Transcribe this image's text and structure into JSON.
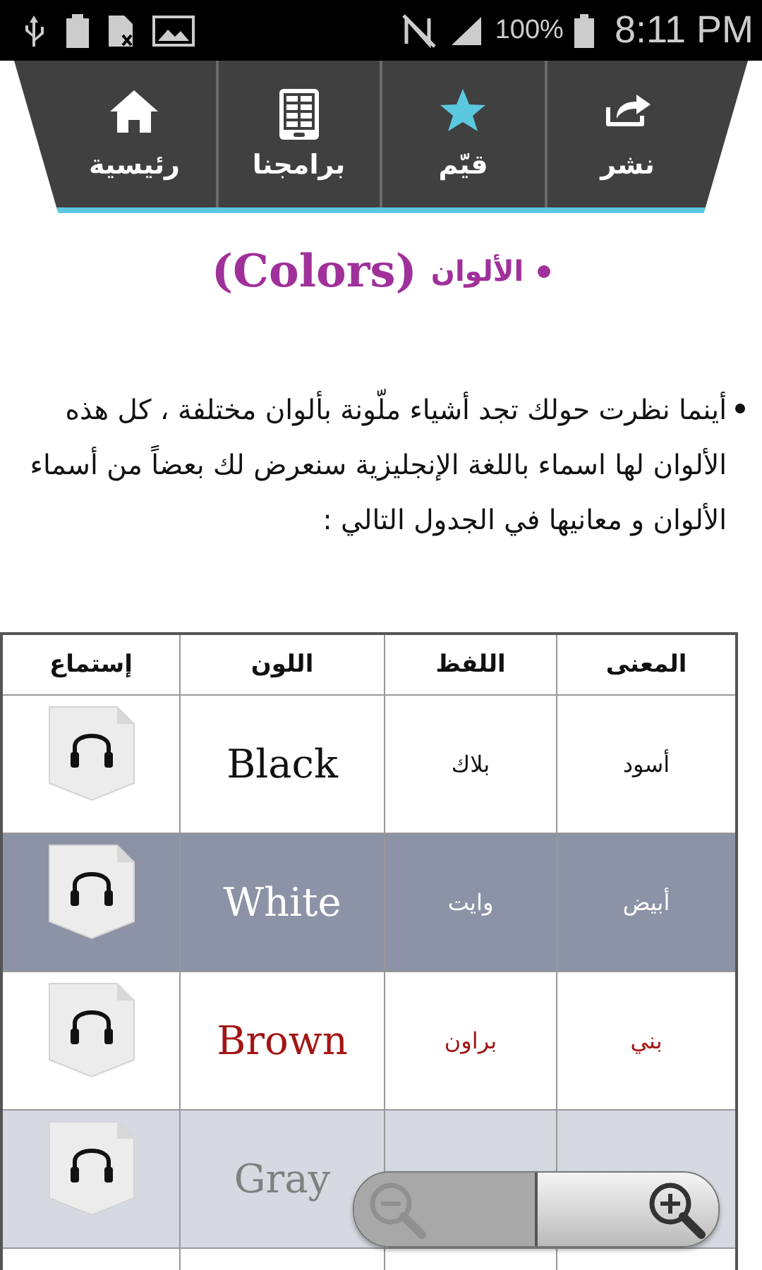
{
  "status_bar": {
    "battery_text": "100%",
    "time": "8:11 PM"
  },
  "nav": [
    {
      "label": "نشر"
    },
    {
      "label": "قيّم"
    },
    {
      "label": "برامجنا"
    },
    {
      "label": "رئيسية"
    }
  ],
  "title": {
    "arabic": "الألوان",
    "english": "(Colors)"
  },
  "intro": "أينما نظرت حولك تجد أشياء ملّونة بألوان مختلفة ، كل هذه الألوان لها اسماء باللغة الإنجليزية سنعرض لك بعضاً من أسماء الألوان و معانيها في الجدول التالي :",
  "table": {
    "columns": [
      "المعنى",
      "اللفظ",
      "اللون",
      "إستماع"
    ],
    "rows": [
      {
        "meaning": "أسود",
        "pronunciation": "بلاك",
        "color_name": "Black",
        "color": "#111111"
      },
      {
        "meaning": "أبيض",
        "pronunciation": "وايت",
        "color_name": "White",
        "color": "#ffffff"
      },
      {
        "meaning": "بني",
        "pronunciation": "براون",
        "color_name": "Brown",
        "color": "#a31515"
      },
      {
        "color_name": "Gray",
        "color": "#808080"
      }
    ]
  },
  "zoom_controls": [
    {
      "kind": "zoom_out",
      "disabled": true
    },
    {
      "kind": "zoom_in",
      "disabled": false
    }
  ]
}
